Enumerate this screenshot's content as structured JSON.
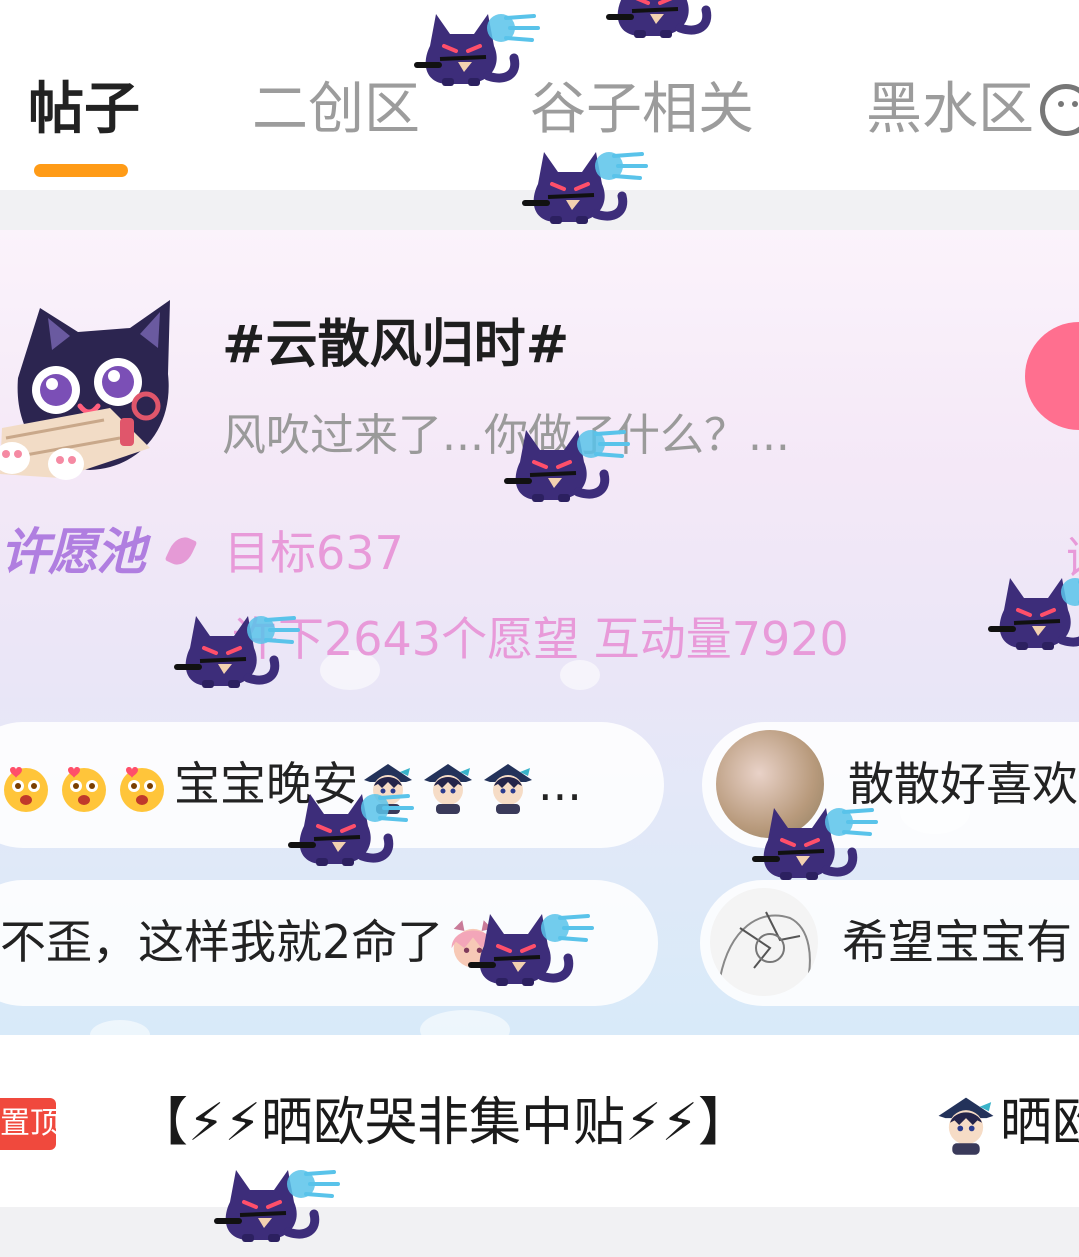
{
  "tabs": [
    {
      "label": "帖子",
      "active": true
    },
    {
      "label": "二创区",
      "active": false
    },
    {
      "label": "谷子相关",
      "active": false
    },
    {
      "label": "黑水区",
      "active": false
    }
  ],
  "topic": {
    "title": "#云散风归时#",
    "description": "风吹过来了...你做了什么？...",
    "wish_logo": "许愿池",
    "goal": "目标637",
    "stats": "许下2643个愿望 互动量7920",
    "right_partial_label": "谜"
  },
  "bubbles": [
    {
      "text": "宝宝晚安",
      "suffix": "..."
    },
    {
      "text": "散散好喜欢"
    },
    {
      "text": "不歪，这样我就2命了"
    },
    {
      "text": "希望宝宝有"
    }
  ],
  "pinned": {
    "badge": "置顶",
    "title": "【⚡⚡晒欧哭非集中贴⚡⚡】",
    "next_title": "晒欧"
  },
  "colors": {
    "accent": "#ff9b17",
    "wish_pink": "#e89ad9",
    "pin_red": "#f0493d",
    "join_button": "#ff6f8f"
  }
}
